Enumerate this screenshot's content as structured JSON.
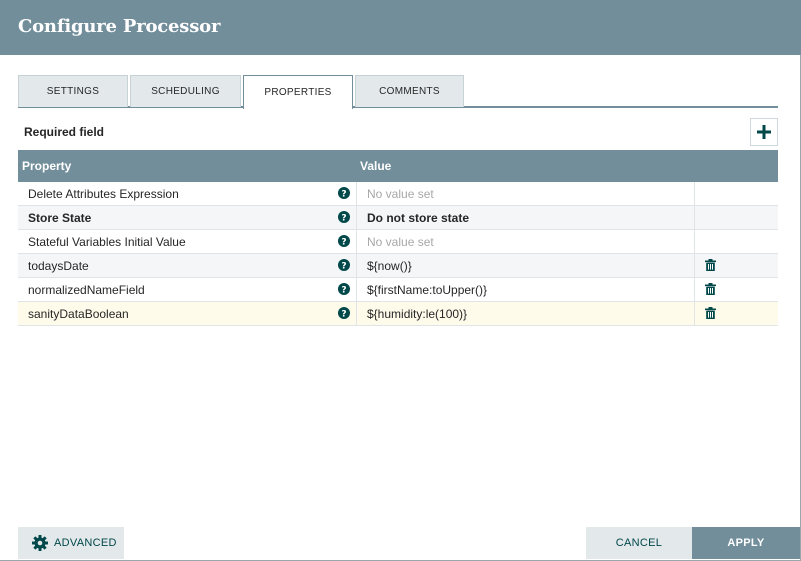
{
  "header": {
    "title": "Configure Processor"
  },
  "tabs": [
    {
      "label": "SETTINGS"
    },
    {
      "label": "SCHEDULING"
    },
    {
      "label": "PROPERTIES"
    },
    {
      "label": "COMMENTS"
    }
  ],
  "properties": {
    "required_label": "Required field",
    "add_icon": "plus-icon",
    "columns": {
      "property": "Property",
      "value": "Value"
    },
    "rows": [
      {
        "name": "Delete Attributes Expression",
        "value": "No value set"
      },
      {
        "name": "Store State",
        "value": "Do not store state"
      },
      {
        "name": "Stateful Variables Initial Value",
        "value": "No value set"
      },
      {
        "name": "todaysDate",
        "value": "${now()}"
      },
      {
        "name": "normalizedNameField",
        "value": "${firstName:toUpper()}"
      },
      {
        "name": "sanityDataBoolean",
        "value": "${humidity:le(100)}"
      }
    ]
  },
  "footer": {
    "advanced_label": "ADVANCED",
    "cancel_label": "CANCEL",
    "apply_label": "APPLY"
  },
  "colors": {
    "header": "#728e9b",
    "accent_icon": "#004849",
    "selected_row": "#fffbeb"
  }
}
